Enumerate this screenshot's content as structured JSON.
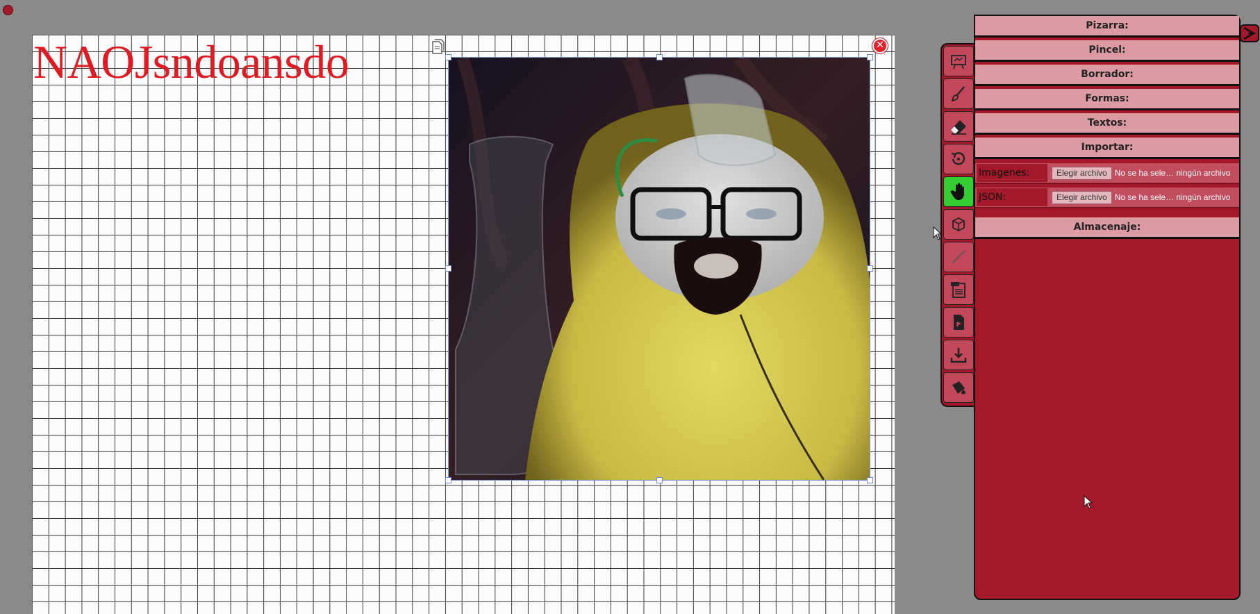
{
  "canvas": {
    "text": "NAOJsndoansdo"
  },
  "image": {
    "subject": "cat dressed as Walter White in yellow hazmat suit"
  },
  "toolbar": {
    "tools": [
      {
        "name": "pizarra",
        "icon": "whiteboard-icon"
      },
      {
        "name": "pincel",
        "icon": "brush-icon"
      },
      {
        "name": "borrador",
        "icon": "eraser-icon"
      },
      {
        "name": "deshacer",
        "icon": "undo-icon"
      },
      {
        "name": "mover",
        "icon": "hand-icon",
        "active": true
      },
      {
        "name": "formas",
        "icon": "cube-icon"
      },
      {
        "name": "linea",
        "icon": "line-icon"
      },
      {
        "name": "texto",
        "icon": "text-file-icon"
      },
      {
        "name": "documento",
        "icon": "document-icon"
      },
      {
        "name": "descargar",
        "icon": "download-icon"
      },
      {
        "name": "relleno",
        "icon": "fill-bucket-icon"
      }
    ]
  },
  "panel": {
    "sections": {
      "pizarra": "Pizarra:",
      "pincel": "Pincel:",
      "borrador": "Borrador:",
      "formas": "Formas:",
      "textos": "Textos:",
      "importar": "Importar:",
      "almacenaje": "Almacenaje:"
    },
    "imports": [
      {
        "label": "Imagenes:",
        "button": "Elegir archivo",
        "status": "No se ha sele… ningún archivo"
      },
      {
        "label": "JSON:",
        "button": "Elegir archivo",
        "status": "No se ha sele… ningún archivo"
      }
    ]
  },
  "colors": {
    "accent": "#a3182b",
    "section_bg": "#dc9aa3",
    "active_tool": "#33cc33",
    "canvas_text": "#e01a22"
  }
}
